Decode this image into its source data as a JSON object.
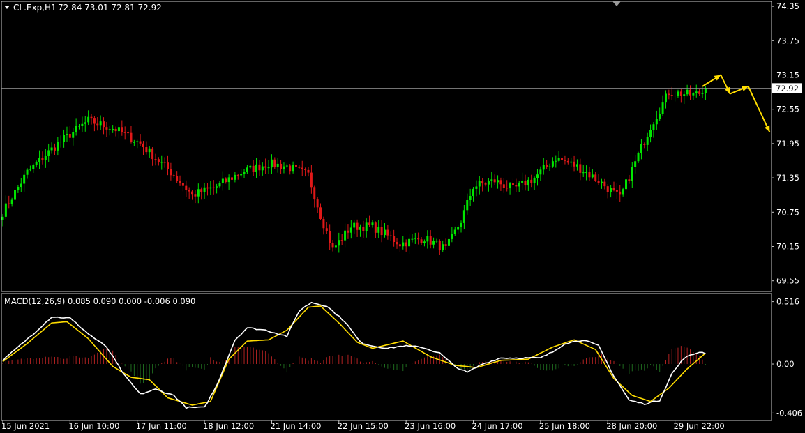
{
  "header": {
    "symbol_timeframe": "CL.Exp,H1",
    "ohlc": "72.84 73.01 72.81 72.92"
  },
  "macd_header": {
    "label": "MACD(12,26,9) 0.085 0.090 0.000 -0.006 0.090"
  },
  "colors": {
    "background": "#000000",
    "frame": "#c8c8c8",
    "bull": "#00e600",
    "bear": "#e01818",
    "bid_line": "#9a9a9a",
    "macd_line": "#ffffff",
    "signal_line": "#ffdd00",
    "hist_pos": "#b22222",
    "hist_neg": "#1f6b1f",
    "arrow": "#ffdd00"
  },
  "chart_data": [
    {
      "type": "candlestick",
      "name_panel": "price",
      "ylim": [
        69.4,
        74.4
      ],
      "y_ticks": [
        "74.35",
        "73.75",
        "73.15",
        "72.55",
        "71.95",
        "71.35",
        "70.75",
        "70.15",
        "69.55"
      ],
      "current_price_label": "72.92",
      "current_price": 72.92,
      "num_bars": 250,
      "anchor_closes": [
        [
          0,
          70.75
        ],
        [
          8,
          71.45
        ],
        [
          18,
          71.95
        ],
        [
          28,
          72.35
        ],
        [
          37,
          72.2
        ],
        [
          45,
          71.95
        ],
        [
          55,
          71.45
        ],
        [
          62,
          71.05
        ],
        [
          70,
          71.2
        ],
        [
          78,
          71.45
        ],
        [
          87,
          71.6
        ],
        [
          93,
          71.55
        ],
        [
          100,
          71.4
        ],
        [
          104,
          70.7
        ],
        [
          108,
          70.1
        ],
        [
          114,
          70.5
        ],
        [
          121,
          70.5
        ],
        [
          130,
          70.2
        ],
        [
          138,
          70.3
        ],
        [
          145,
          70.1
        ],
        [
          150,
          70.6
        ],
        [
          154,
          71.2
        ],
        [
          161,
          71.3
        ],
        [
          167,
          71.15
        ],
        [
          174,
          71.35
        ],
        [
          181,
          71.7
        ],
        [
          188,
          71.55
        ],
        [
          195,
          71.3
        ],
        [
          202,
          71.0
        ],
        [
          206,
          71.5
        ],
        [
          212,
          72.25
        ],
        [
          218,
          72.85
        ],
        [
          226,
          72.8
        ],
        [
          235,
          72.95
        ],
        [
          240,
          72.95
        ]
      ],
      "note_extra": []
    },
    {
      "type": "line",
      "name_panel": "macd",
      "ylim": [
        -0.45,
        0.56
      ],
      "y_ticks": [
        "0.516",
        "0.00",
        "-0.406"
      ],
      "macd_anchor": [
        [
          0,
          0.03
        ],
        [
          10,
          0.25
        ],
        [
          16,
          0.39
        ],
        [
          22,
          0.38
        ],
        [
          28,
          0.25
        ],
        [
          34,
          0.14
        ],
        [
          40,
          -0.1
        ],
        [
          45,
          -0.25
        ],
        [
          50,
          -0.21
        ],
        [
          56,
          -0.26
        ],
        [
          60,
          -0.36
        ],
        [
          66,
          -0.36
        ],
        [
          70,
          -0.18
        ],
        [
          76,
          0.2
        ],
        [
          80,
          0.3
        ],
        [
          86,
          0.28
        ],
        [
          93,
          0.23
        ],
        [
          97,
          0.44
        ],
        [
          101,
          0.51
        ],
        [
          106,
          0.48
        ],
        [
          112,
          0.35
        ],
        [
          117,
          0.18
        ],
        [
          121,
          0.15
        ],
        [
          126,
          0.13
        ],
        [
          131,
          0.15
        ],
        [
          137,
          0.14
        ],
        [
          143,
          0.09
        ],
        [
          148,
          -0.02
        ],
        [
          152,
          -0.07
        ],
        [
          157,
          0.0
        ],
        [
          163,
          0.05
        ],
        [
          170,
          0.05
        ],
        [
          176,
          0.05
        ],
        [
          180,
          0.1
        ],
        [
          184,
          0.17
        ],
        [
          190,
          0.2
        ],
        [
          195,
          0.15
        ],
        [
          200,
          -0.1
        ],
        [
          205,
          -0.3
        ],
        [
          210,
          -0.33
        ],
        [
          215,
          -0.3
        ],
        [
          219,
          -0.08
        ],
        [
          223,
          0.05
        ],
        [
          228,
          0.1
        ],
        [
          230,
          0.09
        ]
      ],
      "signal_anchor": [
        [
          0,
          0.02
        ],
        [
          8,
          0.17
        ],
        [
          16,
          0.34
        ],
        [
          21,
          0.35
        ],
        [
          28,
          0.21
        ],
        [
          36,
          -0.02
        ],
        [
          42,
          -0.11
        ],
        [
          48,
          -0.13
        ],
        [
          54,
          -0.28
        ],
        [
          62,
          -0.34
        ],
        [
          68,
          -0.31
        ],
        [
          74,
          0.04
        ],
        [
          80,
          0.19
        ],
        [
          87,
          0.2
        ],
        [
          93,
          0.28
        ],
        [
          100,
          0.47
        ],
        [
          104,
          0.48
        ],
        [
          110,
          0.34
        ],
        [
          116,
          0.18
        ],
        [
          121,
          0.13
        ],
        [
          131,
          0.19
        ],
        [
          140,
          0.06
        ],
        [
          148,
          -0.01
        ],
        [
          155,
          -0.03
        ],
        [
          163,
          0.03
        ],
        [
          172,
          0.04
        ],
        [
          180,
          0.14
        ],
        [
          187,
          0.2
        ],
        [
          194,
          0.12
        ],
        [
          200,
          -0.12
        ],
        [
          206,
          -0.26
        ],
        [
          212,
          -0.31
        ],
        [
          218,
          -0.2
        ],
        [
          224,
          -0.04
        ],
        [
          230,
          0.09
        ]
      ]
    }
  ],
  "x_ticks": [
    "15 Jun 2021",
    "16 Jun 10:00",
    "17 Jun 11:00",
    "18 Jun 12:00",
    "21 Jun 14:00",
    "22 Jun 15:00",
    "23 Jun 16:00",
    "24 Jun 17:00",
    "25 Jun 18:00",
    "28 Jun 20:00",
    "29 Jun 22:00"
  ],
  "x_tick_bars": [
    0,
    22,
    44,
    66,
    88,
    110,
    132,
    154,
    176,
    198,
    220
  ],
  "forecast_arrows": [
    {
      "from": [
        229,
        72.95
      ],
      "to": [
        235,
        73.15
      ]
    },
    {
      "from": [
        235,
        73.15
      ],
      "to": [
        238,
        72.82
      ]
    },
    {
      "from": [
        238,
        72.82
      ],
      "to": [
        244,
        72.95
      ]
    },
    {
      "from": [
        244,
        72.95
      ],
      "to": [
        251,
        72.15
      ]
    }
  ]
}
